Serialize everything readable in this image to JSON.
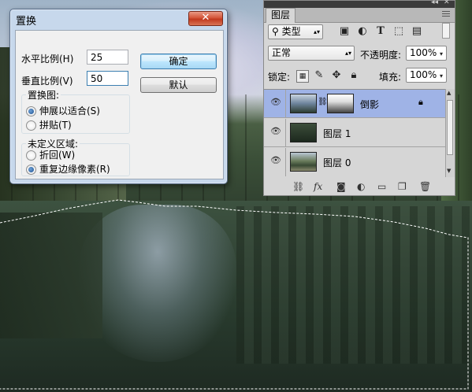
{
  "dialog": {
    "title": "置换",
    "close_glyph": "✕",
    "h_scale_label": "水平比例(H)",
    "h_scale_value": "25",
    "v_scale_label": "垂直比例(V)",
    "v_scale_value": "50",
    "ok_label": "确定",
    "default_label": "默认",
    "map_group": {
      "label": "置换图:",
      "options": [
        "伸展以适合(S)",
        "拼贴(T)"
      ],
      "selected": 0
    },
    "undefined_group": {
      "label": "未定义区域:",
      "options": [
        "折回(W)",
        "重复边缘像素(R)"
      ],
      "selected": 1
    }
  },
  "layers_panel": {
    "tab_label": "图层",
    "filter_label": "类型",
    "filter_icons": [
      "image-filter-icon",
      "adjustment-filter-icon",
      "type-filter-icon",
      "shape-filter-icon",
      "smart-object-filter-icon"
    ],
    "blend_mode": "正常",
    "opacity_label": "不透明度:",
    "opacity_value": "100%",
    "lock_label": "锁定:",
    "fill_label": "填充:",
    "fill_value": "100%",
    "layers": [
      {
        "name": "倒影",
        "selected": true,
        "has_mask": true,
        "locked": true
      },
      {
        "name": "图层 1",
        "selected": false,
        "has_mask": false,
        "locked": false
      },
      {
        "name": "图层 0",
        "selected": false,
        "has_mask": false,
        "locked": false
      }
    ],
    "footer_icons": [
      "link-icon",
      "fx-icon",
      "mask-icon",
      "adjustment-icon",
      "group-folder-icon",
      "new-layer-icon",
      "trash-icon"
    ]
  }
}
